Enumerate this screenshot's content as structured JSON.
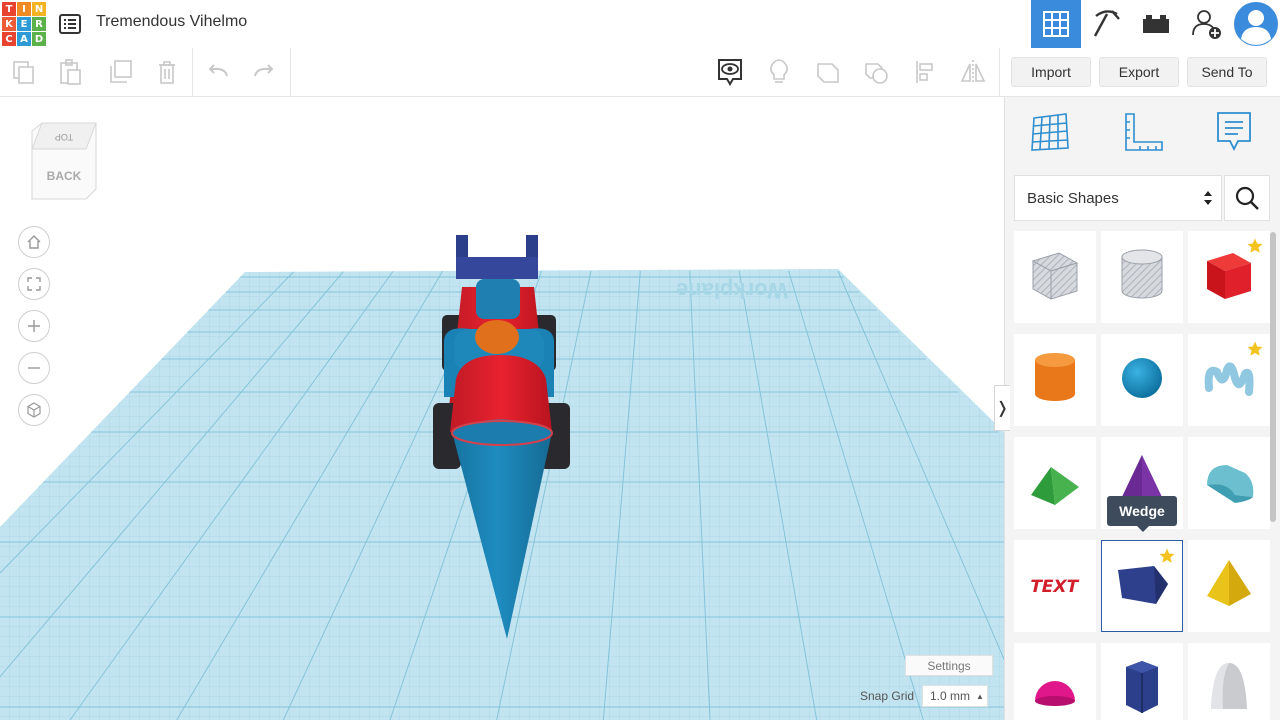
{
  "logo": {
    "letters": [
      "T",
      "I",
      "N",
      "K",
      "E",
      "R",
      "C",
      "A",
      "D"
    ],
    "colors": [
      "#e8432f",
      "#f08a24",
      "#f4b322",
      "#ef5a36",
      "#2e9bd6",
      "#5cb24a",
      "#e8432f",
      "#2e9bd6",
      "#5cb24a"
    ]
  },
  "header": {
    "title": "Tremendous Vihelmo",
    "buttons": [
      {
        "name": "3d-design-button",
        "icon": "grid-icon",
        "active": true
      },
      {
        "name": "codeblocks-button",
        "icon": "pickaxe-icon"
      },
      {
        "name": "lego-bricks-button",
        "icon": "bricks-icon"
      },
      {
        "name": "invite-people-button",
        "icon": "add-person-icon"
      },
      {
        "name": "user-profile-button",
        "icon": "avatar-icon"
      }
    ]
  },
  "toolbar": {
    "import_label": "Import",
    "export_label": "Export",
    "send_to_label": "Send To"
  },
  "viewcube": {
    "top_label": "TOP",
    "front_label": "BACK"
  },
  "workplane": {
    "watermark": "Workplane",
    "color": "#bfe3ef"
  },
  "bottom": {
    "settings_label": "Settings",
    "snap_label": "Snap Grid",
    "snap_value": "1.0 mm"
  },
  "panel": {
    "category": "Basic Shapes",
    "tooltip": "Wedge",
    "shapes": [
      {
        "name": "box-hole",
        "starred": false
      },
      {
        "name": "cylinder-hole",
        "starred": false
      },
      {
        "name": "box",
        "starred": true
      },
      {
        "name": "cylinder",
        "starred": false
      },
      {
        "name": "sphere",
        "starred": false
      },
      {
        "name": "scribble",
        "starred": true
      },
      {
        "name": "roof",
        "starred": false
      },
      {
        "name": "cone",
        "starred": false
      },
      {
        "name": "round-roof",
        "starred": false
      },
      {
        "name": "text",
        "starred": false
      },
      {
        "name": "wedge",
        "starred": true,
        "selected": true
      },
      {
        "name": "pyramid",
        "starred": false
      },
      {
        "name": "half-sphere",
        "starred": false
      },
      {
        "name": "polygon",
        "starred": false
      },
      {
        "name": "paraboloid",
        "starred": false
      }
    ]
  },
  "colors": {
    "accent": "#2b5ea8",
    "active_tab": "#3a8bdc",
    "blue_part": "#1a82b5",
    "red_part": "#e0202e",
    "navy_part": "#2c3f8a"
  }
}
